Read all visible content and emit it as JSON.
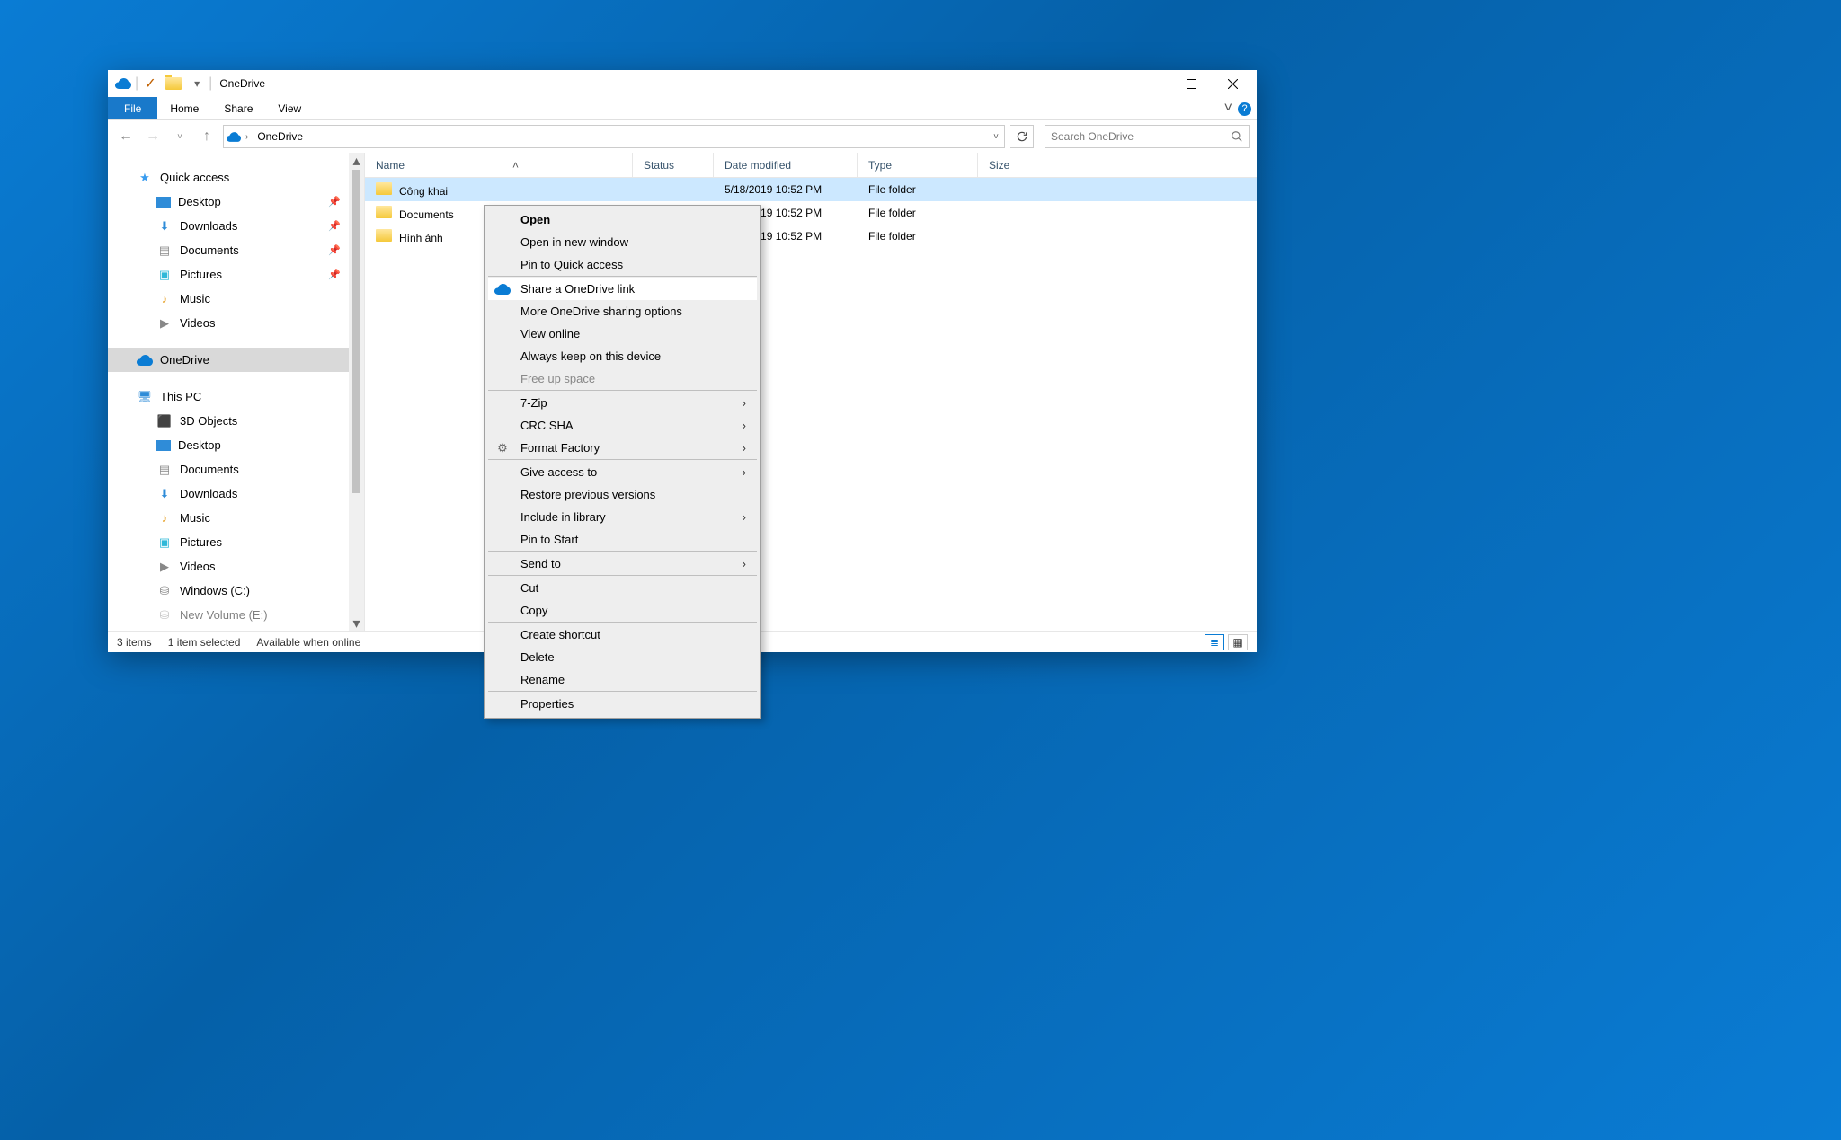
{
  "titlebar": {
    "title": "OneDrive"
  },
  "ribbon": {
    "file": "File",
    "home": "Home",
    "share": "Share",
    "view": "View"
  },
  "breadcrumb": {
    "root": "OneDrive"
  },
  "search": {
    "placeholder": "Search OneDrive"
  },
  "sidebar": {
    "quick_access": "Quick access",
    "qa_items": [
      {
        "label": "Desktop",
        "pinned": true
      },
      {
        "label": "Downloads",
        "pinned": true
      },
      {
        "label": "Documents",
        "pinned": true
      },
      {
        "label": "Pictures",
        "pinned": true
      },
      {
        "label": "Music",
        "pinned": false
      },
      {
        "label": "Videos",
        "pinned": false
      }
    ],
    "onedrive": "OneDrive",
    "this_pc": "This PC",
    "pc_items": [
      {
        "label": "3D Objects"
      },
      {
        "label": "Desktop"
      },
      {
        "label": "Documents"
      },
      {
        "label": "Downloads"
      },
      {
        "label": "Music"
      },
      {
        "label": "Pictures"
      },
      {
        "label": "Videos"
      },
      {
        "label": "Windows (C:)"
      },
      {
        "label": "New Volume (E:)"
      }
    ]
  },
  "columns": {
    "name": "Name",
    "status": "Status",
    "date": "Date modified",
    "type": "Type",
    "size": "Size"
  },
  "rows": [
    {
      "name": "Công khai",
      "date": "5/18/2019 10:52 PM",
      "type": "File folder"
    },
    {
      "name": "Documents",
      "date": "5/18/2019 10:52 PM",
      "type": "File folder"
    },
    {
      "name": "Hình ảnh",
      "date": "5/18/2019 10:52 PM",
      "type": "File folder"
    }
  ],
  "statusbar": {
    "count": "3 items",
    "sel": "1 item selected",
    "avail": "Available when online"
  },
  "context": {
    "open": "Open",
    "open_new": "Open in new window",
    "pin_qa": "Pin to Quick access",
    "share_od": "Share a OneDrive link",
    "more_od": "More OneDrive sharing options",
    "view_online": "View online",
    "always_keep": "Always keep on this device",
    "free_up": "Free up space",
    "sevenzip": "7-Zip",
    "crc": "CRC SHA",
    "ff": "Format Factory",
    "give_access": "Give access to",
    "restore": "Restore previous versions",
    "include_lib": "Include in library",
    "pin_start": "Pin to Start",
    "send_to": "Send to",
    "cut": "Cut",
    "copy": "Copy",
    "shortcut": "Create shortcut",
    "delete": "Delete",
    "rename": "Rename",
    "props": "Properties"
  }
}
